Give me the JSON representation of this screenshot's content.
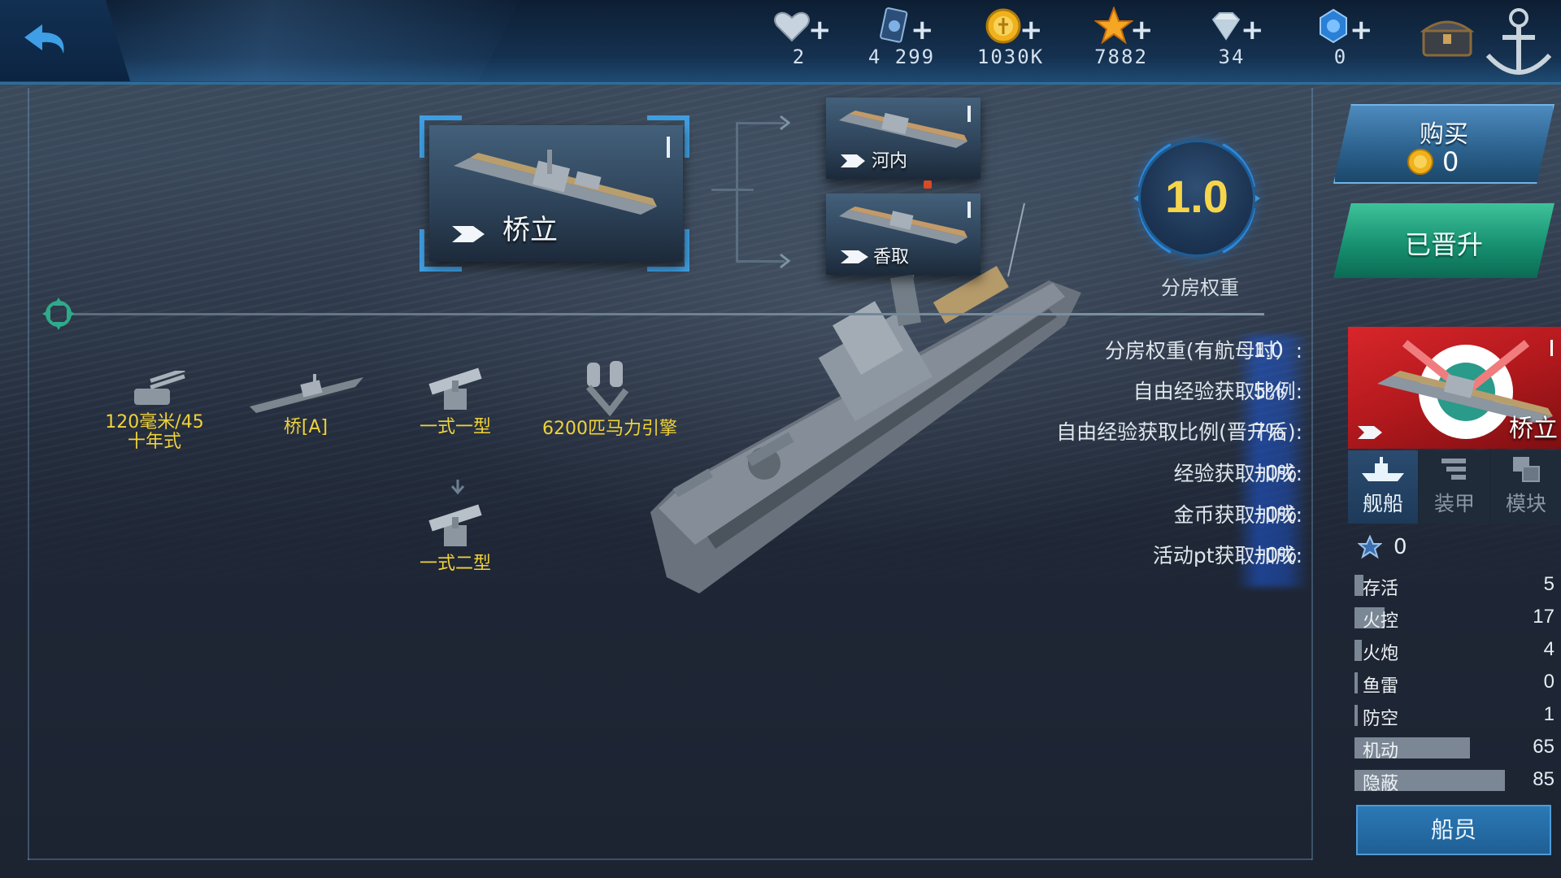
{
  "topbar": {
    "resources": [
      {
        "id": "hearts",
        "value": "2",
        "icon": "heart-icon"
      },
      {
        "id": "cards",
        "value": "4 299",
        "icon": "card-icon"
      },
      {
        "id": "gold",
        "value": "1030K",
        "icon": "gold-coin-icon"
      },
      {
        "id": "stars",
        "value": "7882",
        "icon": "star-icon"
      },
      {
        "id": "diamonds",
        "value": "34",
        "icon": "diamond-icon"
      },
      {
        "id": "blue_token",
        "value": "0",
        "icon": "blue-gem-icon"
      }
    ]
  },
  "tree": {
    "current_ship": {
      "name": "桥立"
    },
    "next_ships": [
      {
        "name": "河内"
      },
      {
        "name": "香取"
      }
    ],
    "weight_value": "1.0",
    "weight_label": "分房权重"
  },
  "modules": [
    {
      "label": "120毫米/45\n十年式",
      "icon": "gun-icon"
    },
    {
      "label": "桥[A]",
      "icon": "hull-icon"
    },
    {
      "label": "一式一型",
      "icon": "radar-icon"
    },
    {
      "label": "6200匹马力引擎",
      "icon": "engine-icon"
    },
    {
      "label": "一式二型",
      "icon": "radar-icon"
    }
  ],
  "stats": [
    {
      "label": "分房权重(有航母时）:",
      "value": "1.0"
    },
    {
      "label": "自由经验获取比例:",
      "value": "5%"
    },
    {
      "label": "自由经验获取比例(晋升后):",
      "value": "7%"
    },
    {
      "label": "经验获取加成:",
      "value": "+0%"
    },
    {
      "label": "金币获取加成:",
      "value": "+0%"
    },
    {
      "label": "活动pt获取加成:",
      "value": "+0%"
    }
  ],
  "side": {
    "buy_label": "购买",
    "buy_cost": "0",
    "promoted_label": "已晋升",
    "portrait_name": "桥立",
    "tabs": [
      {
        "label": "舰船",
        "icon": "ship-tab-icon",
        "active": true
      },
      {
        "label": "装甲",
        "icon": "armor-tab-icon",
        "active": false
      },
      {
        "label": "模块",
        "icon": "module-tab-icon",
        "active": false
      }
    ],
    "star_value": "0",
    "attributes": [
      {
        "name": "存活",
        "value": "5",
        "fill": 0.05
      },
      {
        "name": "火控",
        "value": "17",
        "fill": 0.17
      },
      {
        "name": "火炮",
        "value": "4",
        "fill": 0.04
      },
      {
        "name": "鱼雷",
        "value": "0",
        "fill": 0.0
      },
      {
        "name": "防空",
        "value": "1",
        "fill": 0.01
      },
      {
        "name": "机动",
        "value": "65",
        "fill": 0.65
      },
      {
        "name": "隐蔽",
        "value": "85",
        "fill": 0.85
      }
    ],
    "crew_label": "船员"
  }
}
